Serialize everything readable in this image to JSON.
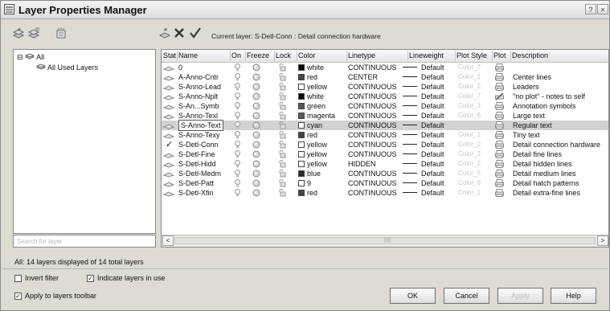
{
  "window": {
    "title": "Layer Properties Manager",
    "help_glyph": "?",
    "close_glyph": "×"
  },
  "current_layer": "Current layer: S-Detl-Conn : Detail connection hardware",
  "tree": {
    "all": "All",
    "all_used": "All Used Layers",
    "expander": "⊟"
  },
  "search_placeholder": "Search for layer",
  "columns": [
    "Stat",
    "Name",
    "On",
    "Freeze",
    "Lock",
    "Color",
    "Linetype",
    "Lineweight",
    "Plot Style",
    "Plot",
    "Description"
  ],
  "layers": [
    {
      "name": "0",
      "color": "white",
      "hex": "#000000",
      "linetype": "CONTINUOUS",
      "lineweight": "Default",
      "plot_style": "Color_7",
      "description": ""
    },
    {
      "name": "A-Anno-Cntr",
      "color": "red",
      "hex": "#444444",
      "linetype": "CENTER",
      "lineweight": "Default",
      "plot_style": "Color_1",
      "description": "Center lines"
    },
    {
      "name": "S-Anno-Lead",
      "color": "yellow",
      "hex": "#ffffff",
      "linetype": "CONTINUOUS",
      "lineweight": "Default",
      "plot_style": "Color_2",
      "description": "Leaders"
    },
    {
      "name": "S-Anno-Nplt",
      "color": "white",
      "hex": "#000000",
      "linetype": "CONTINUOUS",
      "lineweight": "Default",
      "plot_style": "Color_7",
      "description": "\"no plot\" - notes to self"
    },
    {
      "name": "S-An...Symb",
      "color": "green",
      "hex": "#555555",
      "linetype": "CONTINUOUS",
      "lineweight": "Default",
      "plot_style": "Color_3",
      "description": "Annotation symbols"
    },
    {
      "name": "S-Anno-Texl",
      "color": "magenta",
      "hex": "#5a5a5a",
      "linetype": "CONTINUOUS",
      "lineweight": "Default",
      "plot_style": "Color_6",
      "description": "Large text"
    },
    {
      "name": "S-Anno-Text",
      "color": "cyan",
      "hex": "#ffffff",
      "linetype": "CONTINUOUS",
      "lineweight": "Default",
      "plot_style": "",
      "description": "Regular text"
    },
    {
      "name": "S-Anno-Texy",
      "color": "red",
      "hex": "#444444",
      "linetype": "CONTINUOUS",
      "lineweight": "Default",
      "plot_style": "Color_1",
      "description": "Tiny text"
    },
    {
      "name": "S-Detl-Conn",
      "color": "yellow",
      "hex": "#ffffff",
      "linetype": "CONTINUOUS",
      "lineweight": "Default",
      "plot_style": "Color_2",
      "description": "Detail connection hardware"
    },
    {
      "name": "S-Detl-Fine",
      "color": "yellow",
      "hex": "#ffffff",
      "linetype": "CONTINUOUS",
      "lineweight": "Default",
      "plot_style": "Color_2",
      "description": "Detail fine lines"
    },
    {
      "name": "S-Detl-Hidd",
      "color": "yellow",
      "hex": "#ffffff",
      "linetype": "HIDDEN",
      "lineweight": "Default",
      "plot_style": "Color_2",
      "description": "Detail hidden lines"
    },
    {
      "name": "S-Detl-Medm",
      "color": "blue",
      "hex": "#2b2b2b",
      "linetype": "CONTINUOUS",
      "lineweight": "Default",
      "plot_style": "Color_5",
      "description": "Detail medium lines"
    },
    {
      "name": "S-Detl-Patt",
      "color": "9",
      "hex": "#ffffff",
      "linetype": "CONTINUOUS",
      "lineweight": "Default",
      "plot_style": "Color_9",
      "description": "Detail hatch patterns"
    },
    {
      "name": "S-Detl-Xfin",
      "color": "red",
      "hex": "#444444",
      "linetype": "CONTINUOUS",
      "lineweight": "Default",
      "plot_style": "Color_1",
      "description": "Detail extra-fine lines"
    }
  ],
  "selected_index": 6,
  "current_index": 8,
  "current_mark": "✓",
  "status": "All: 14 layers displayed of 14 total layers",
  "options": {
    "invert_filter": "Invert filter",
    "indicate_in_use": "Indicate layers in use",
    "apply_toolbar": "Apply to layers toolbar"
  },
  "buttons": {
    "ok": "OK",
    "cancel": "Cancel",
    "apply": "Apply",
    "help": "Help"
  },
  "scroll": {
    "left": "<",
    "right": ">",
    "grip": "|||||"
  }
}
